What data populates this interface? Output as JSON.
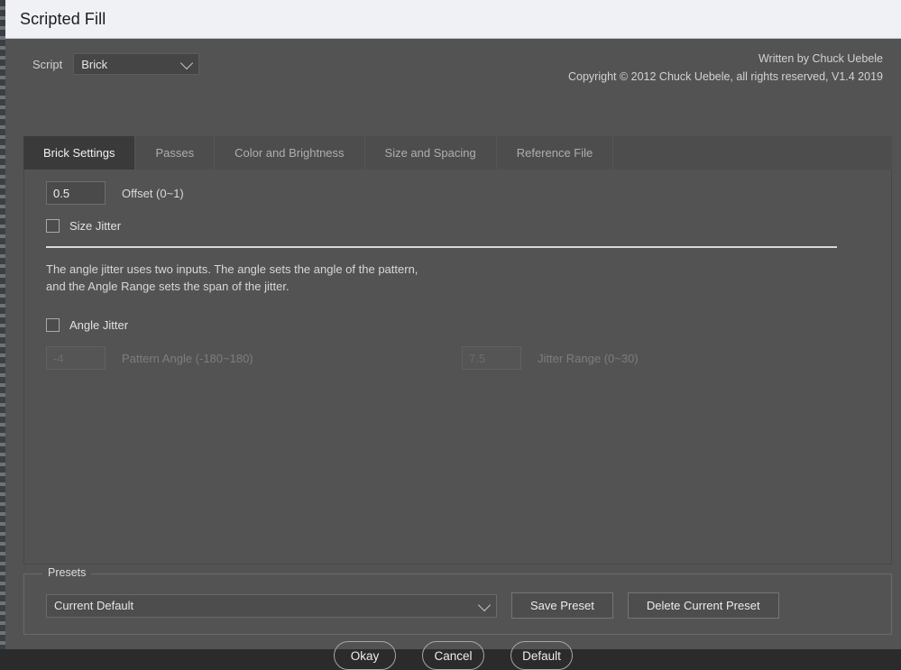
{
  "window": {
    "title": "Scripted Fill"
  },
  "header": {
    "script_label": "Script",
    "script_value": "Brick",
    "author_line": "Written by Chuck Uebele",
    "copyright_line": "Copyright © 2012 Chuck Uebele, all rights reserved, V1.4 2019"
  },
  "tabs": [
    {
      "label": "Brick Settings",
      "active": true
    },
    {
      "label": "Passes",
      "active": false
    },
    {
      "label": "Color and Brightness",
      "active": false
    },
    {
      "label": "Size and Spacing",
      "active": false
    },
    {
      "label": "Reference File",
      "active": false
    }
  ],
  "brick_settings": {
    "offset_value": "0.5",
    "offset_label": "Offset (0~1)",
    "size_jitter_label": "Size Jitter",
    "size_jitter_checked": false,
    "help_text": "The angle jitter uses two inputs.  The angle sets the angle of the pattern,\nand the Angle Range sets the span of the jitter.",
    "angle_jitter_label": "Angle Jitter",
    "angle_jitter_checked": false,
    "pattern_angle_value": "-4",
    "pattern_angle_label": "Pattern Angle (-180~180)",
    "jitter_range_value": "7.5",
    "jitter_range_label": "Jitter Range (0~30)"
  },
  "presets": {
    "legend": "Presets",
    "current_value": "Current Default",
    "save_label": "Save Preset",
    "delete_label": "Delete Current Preset"
  },
  "footer": {
    "okay_label": "Okay",
    "cancel_label": "Cancel",
    "default_label": "Default"
  },
  "colors": {
    "window_bg": "#535353",
    "titlebar_bg": "#eff1f5",
    "tab_strip_bg": "#4d4d4d",
    "tab_active_bg": "#3a3a3a",
    "text_primary": "#e6e6e6",
    "text_disabled": "#7d7d7d"
  }
}
